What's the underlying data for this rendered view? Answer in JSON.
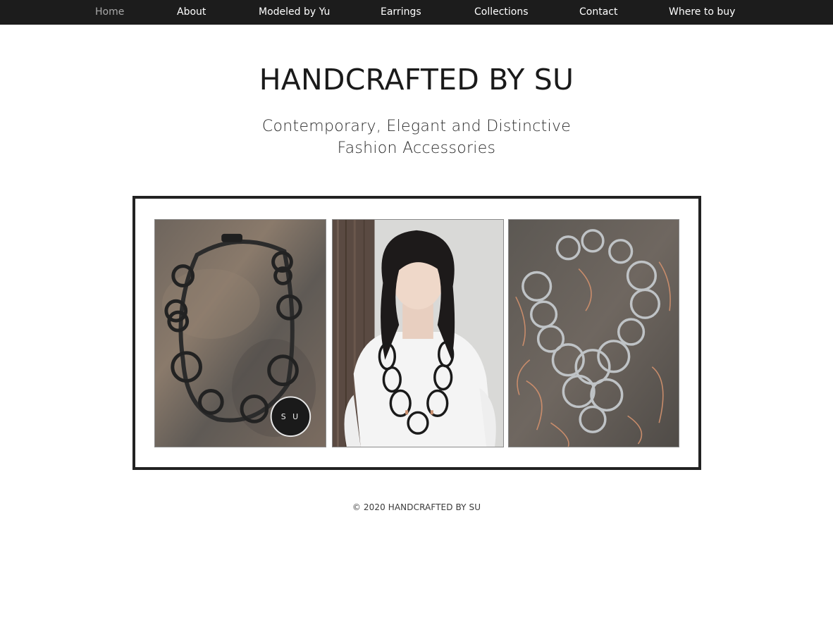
{
  "nav": {
    "items": [
      {
        "label": "Home",
        "active": true
      },
      {
        "label": "About"
      },
      {
        "label": "Modeled by Yu"
      },
      {
        "label": "Earrings"
      },
      {
        "label": "Collections"
      },
      {
        "label": "Contact"
      },
      {
        "label": "Where to buy"
      }
    ]
  },
  "header": {
    "title": "HANDCRAFTED BY SU",
    "tagline_line1": "Contemporary, Elegant and Distinctive",
    "tagline_line2": "Fashion Accessories"
  },
  "gallery": {
    "logo_badge": "S U"
  },
  "footer": {
    "copyright": "© 2020 HANDCRAFTED BY SU"
  },
  "colors": {
    "nav_bg": "#1c1c1c",
    "nav_text": "#ffffff",
    "nav_active": "#a8a8a8",
    "frame_border": "#222222"
  }
}
